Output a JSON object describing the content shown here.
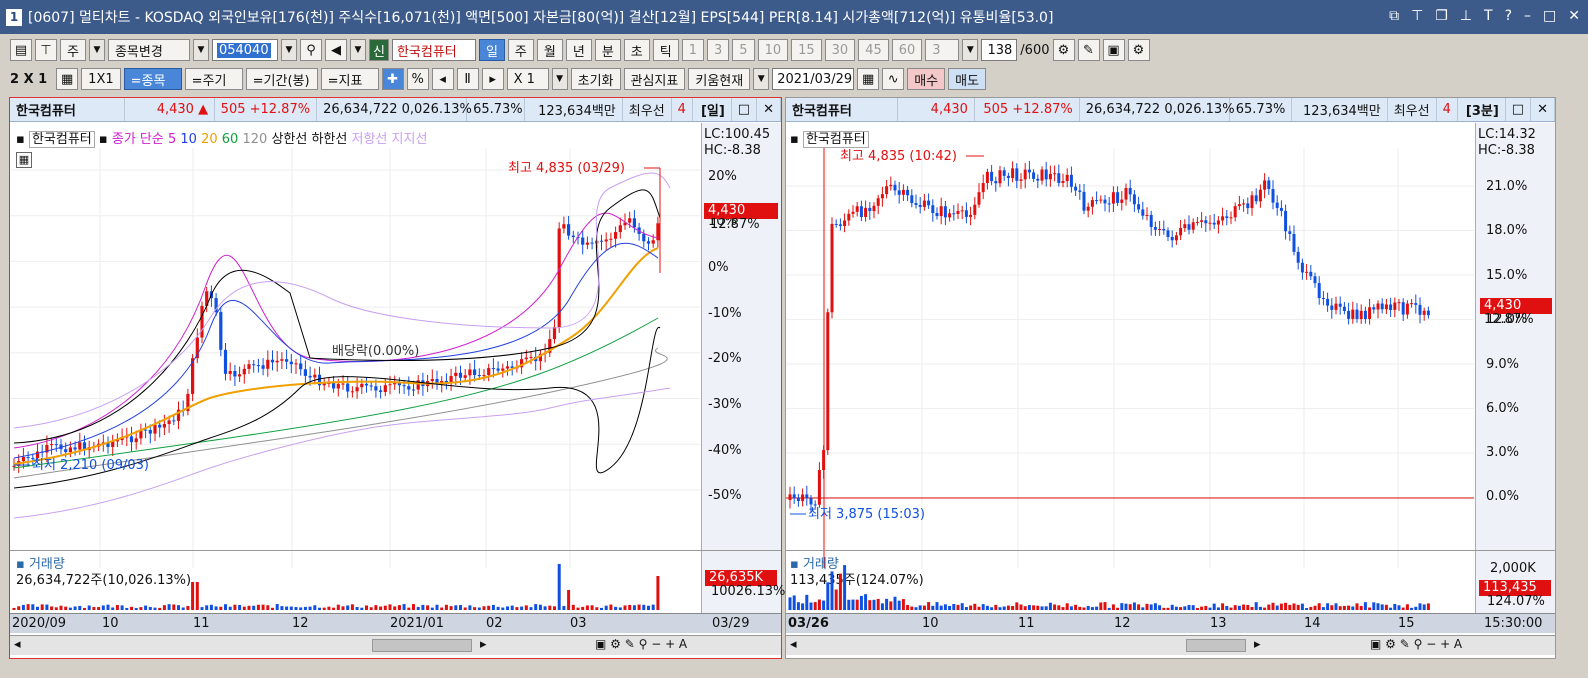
{
  "window": {
    "num": "1",
    "title": "[0607] 멀티차트 - KOSDAQ 외국인보유[176(천)] 주식수[16,071(천)] 액면[500] 자본금[80(억)] 결산[12월] EPS[544] PER[8.14] 시가총액[712(억)] 유통비율[53.0]"
  },
  "toolbar1": {
    "type": "주",
    "mode": "종목변경",
    "code": "054040",
    "new": "신",
    "stock_name": "한국컴퓨터",
    "periods": [
      "일",
      "주",
      "월",
      "년",
      "분",
      "초",
      "틱"
    ],
    "nums": [
      "1",
      "3",
      "5",
      "10",
      "15",
      "30",
      "45",
      "60"
    ],
    "n_sel": "3",
    "count": "138",
    "count_max": "/600"
  },
  "toolbar2": {
    "layout": "2 X 1",
    "layout2": "1X1",
    "btns": [
      "=종목",
      "=주기",
      "=기간(봉)",
      "=지표"
    ],
    "pct": "%",
    "mult": "X 1",
    "reset": "초기화",
    "fav": "관심지표",
    "kiwoom": "키움현재",
    "date": "2021/03/29",
    "buy": "매수",
    "sell": "매도"
  },
  "left": {
    "name": "한국컴퓨터",
    "price": "4,430 ▲",
    "chg": "505 +12.87%",
    "vol": "26,634,722 0,026.13%",
    "ratio": "65.73%",
    "amt": "123,634백만",
    "pref": "최우선",
    "pref2": "4",
    "period": "[일]",
    "legend_name": "한국컴퓨터",
    "legend": [
      "종가 단순",
      "5",
      "10",
      "20",
      "60",
      "120",
      "상한선",
      "하한선",
      "저항선",
      "지지선"
    ],
    "lc": "LC:100.45",
    "hc": "HC:-8.38",
    "high": "최고 4,835 (03/29)",
    "low": "최저 2,210 (09/03)",
    "div": "배당락(0.00%)",
    "yticks": [
      "20%",
      "10%",
      "0%",
      "-10%",
      "-20%",
      "-30%",
      "-40%",
      "-50%"
    ],
    "price_tag": "4,430",
    "pct_tag": "12.87%",
    "vol_label": "거래량",
    "vol_text": "26,634,722주(10,026.13%)",
    "vol_tag": "26,635K",
    "vol_tag2": "10026.13%",
    "xlabels": [
      "2020/09",
      "10",
      "11",
      "12",
      "2021/01",
      "02",
      "03",
      "03/29"
    ]
  },
  "right": {
    "name": "한국컴퓨터",
    "price": "4,430",
    "chg": "505 +12.87%",
    "vol": "26,634,722 0,026.13%",
    "ratio": "65.73%",
    "amt": "123,634백만",
    "pref": "최우선",
    "pref2": "4",
    "period": "[3분]",
    "legend_name": "한국컴퓨터",
    "lc": "LC:14.32",
    "hc": "HC:-8.38",
    "high": "최고 4,835 (10:42)",
    "low": "최저 3,875 (15:03)",
    "yticks": [
      "21.0%",
      "18.0%",
      "15.0%",
      "12.0%",
      "9.0%",
      "6.0%",
      "3.0%",
      "0.0%"
    ],
    "price_tag": "4,430",
    "pct_tag": "12.87%",
    "vol_label": "거래량",
    "vol_text": "113,435주(124.07%)",
    "vol_tick": "2,000K",
    "vol_tag": "113,435",
    "vol_tag2": "124.07%",
    "xlabels": [
      "03/26",
      "10",
      "11",
      "12",
      "13",
      "14",
      "15",
      "15:30:00"
    ]
  },
  "colors": {
    "up": "#e01010",
    "down": "#1050e0",
    "ma5": "#d020d0",
    "ma10": "#2040e0",
    "ma20": "#f0a000",
    "ma60": "#10a040",
    "ma120": "#909090"
  }
}
